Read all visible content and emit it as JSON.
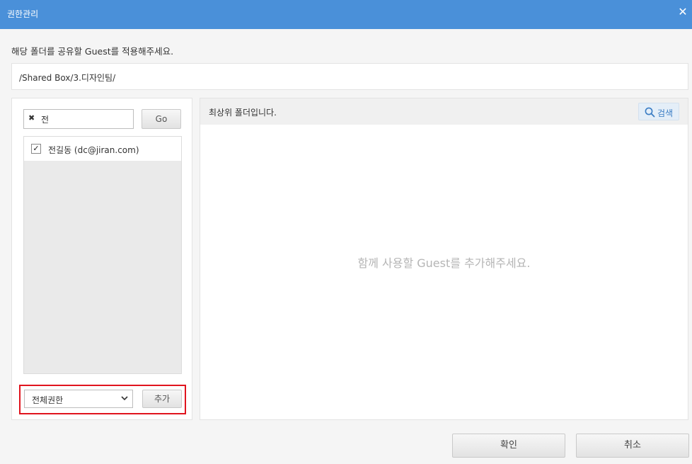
{
  "window": {
    "title": "권한관리",
    "close_label": "✕"
  },
  "instruction": "해당 폴더를 공유할 Guest를 적용해주세요.",
  "path": "/Shared Box/3.디자인팀/",
  "left": {
    "search": {
      "value": "전",
      "clear_glyph": "✖"
    },
    "go_label": "Go",
    "users": [
      {
        "label": "전길동 (dc@jiran.com)",
        "checked": true
      }
    ],
    "permission": {
      "selected": "전체권한"
    },
    "add_label": "추가"
  },
  "right": {
    "header_text": "최상위 폴더입니다.",
    "search_label": "검색",
    "empty_message": "함께 사용할 Guest를 추가해주세요."
  },
  "footer": {
    "ok_label": "확인",
    "cancel_label": "취소"
  },
  "colors": {
    "titlebar": "#4a90d9",
    "highlight_border": "#e0141e",
    "search_btn_text": "#3b7dc4"
  }
}
